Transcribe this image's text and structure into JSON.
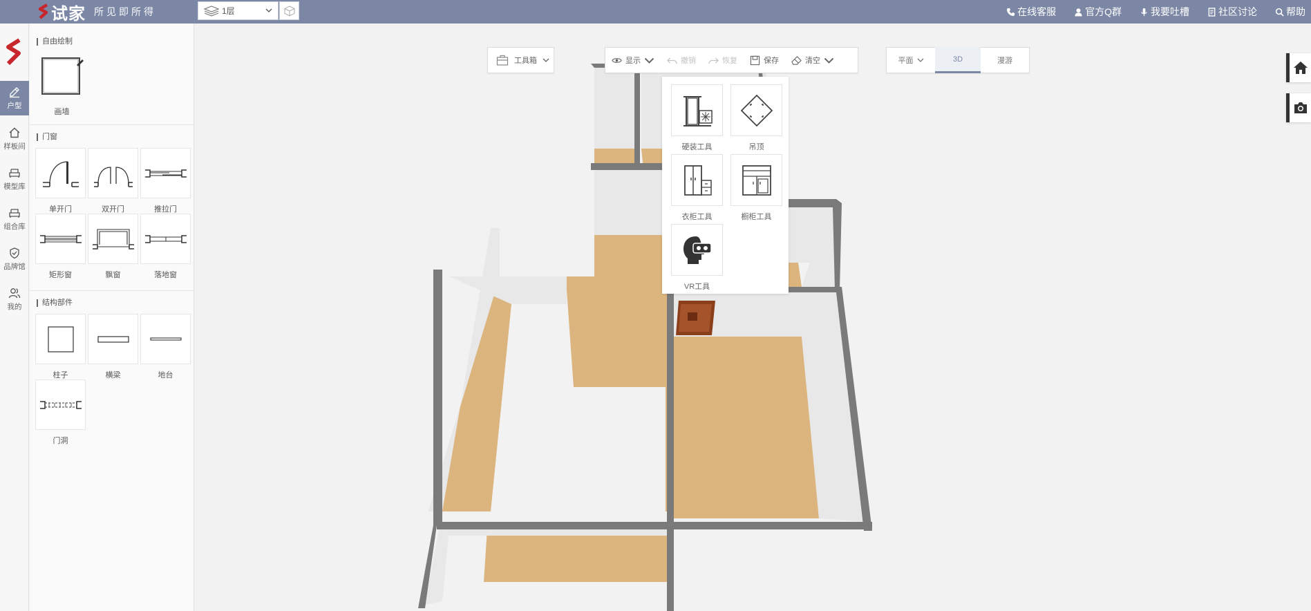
{
  "topbar": {
    "brand_name": "试家",
    "slogan": "所见即所得",
    "floor_value": "1层",
    "links": [
      {
        "label": "在线客服",
        "icon": "phone-icon"
      },
      {
        "label": "官方Q群",
        "icon": "user-icon"
      },
      {
        "label": "我要吐槽",
        "icon": "microphone-icon"
      },
      {
        "label": "社区讨论",
        "icon": "document-icon"
      },
      {
        "label": "帮助",
        "icon": "search-icon"
      }
    ]
  },
  "rail": {
    "items": [
      {
        "label": "户型",
        "icon": "pencil-icon",
        "active": true
      },
      {
        "label": "样板间",
        "icon": "home-icon"
      },
      {
        "label": "模型库",
        "icon": "sofa-icon"
      },
      {
        "label": "组合库",
        "icon": "sofa-icon"
      },
      {
        "label": "品牌馆",
        "icon": "shield-icon"
      },
      {
        "label": "我的",
        "icon": "users-icon"
      }
    ]
  },
  "panel": {
    "sections": {
      "free_draw": {
        "title": "自由绘制",
        "items": [
          "画墙"
        ]
      },
      "doors_windows": {
        "title": "门窗",
        "items": [
          "单开门",
          "双开门",
          "推拉门",
          "矩形窗",
          "飘窗",
          "落地窗"
        ]
      },
      "structure": {
        "title": "结构部件",
        "items": [
          "柱子",
          "横梁",
          "地台",
          "门洞"
        ]
      }
    }
  },
  "toolbar": {
    "toolbox_label": "工具箱",
    "display_label": "显示",
    "undo_label": "撤销",
    "redo_label": "恢复",
    "save_label": "保存",
    "clear_label": "清空"
  },
  "view_tabs": {
    "plan": "平面",
    "three_d": "3D",
    "roam": "漫游",
    "active": "3D"
  },
  "toolbox": {
    "items": [
      {
        "label": "硬装工具",
        "icon": "hardware-tool-icon"
      },
      {
        "label": "吊顶",
        "icon": "ceiling-icon"
      },
      {
        "label": "衣柜工具",
        "icon": "wardrobe-icon"
      },
      {
        "label": "橱柜工具",
        "icon": "cabinet-icon"
      },
      {
        "label": "VR工具",
        "icon": "vr-headset-icon"
      }
    ]
  },
  "side_buttons": [
    {
      "icon": "home-icon"
    },
    {
      "icon": "camera-icon"
    }
  ],
  "colors": {
    "topbar": "#7b87a5",
    "accent": "#7b87a5",
    "floor": "#dcb47e",
    "wall_top": "#707070"
  }
}
